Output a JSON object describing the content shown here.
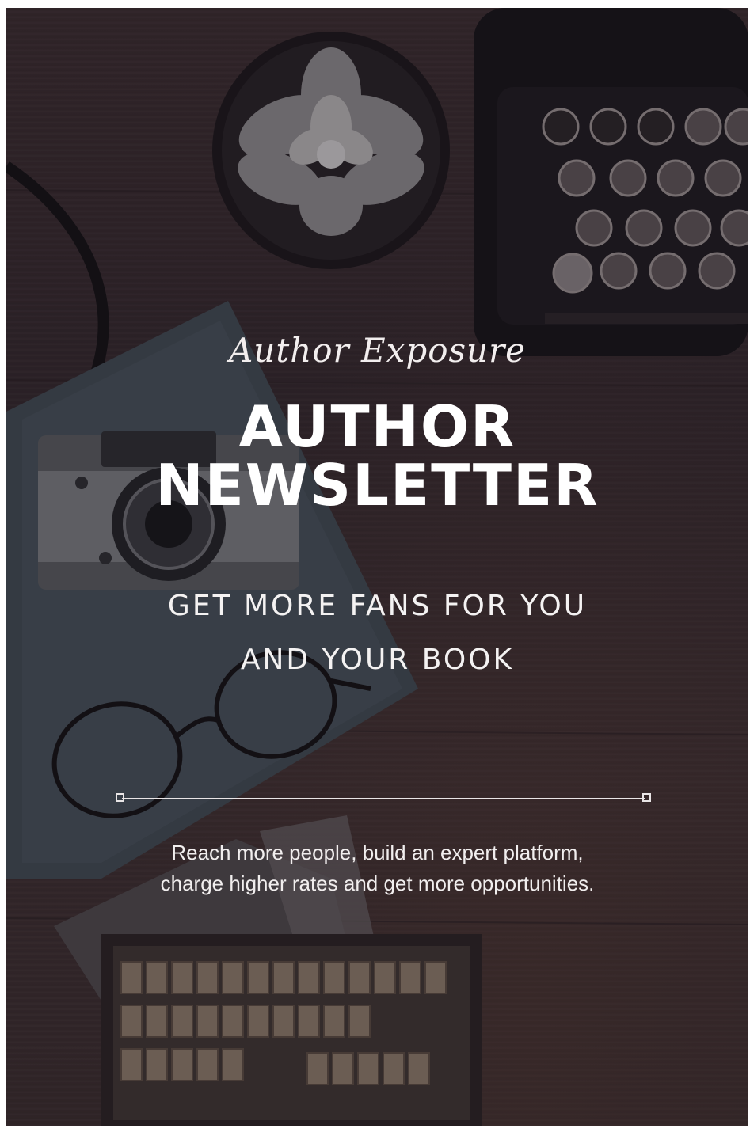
{
  "poster": {
    "script_title": "Author Exposure",
    "title_lines": [
      "AUTHOR",
      "NEWSLETTER"
    ],
    "tagline_lines": [
      "GET MORE FANS FOR YOU",
      "AND YOUR BOOK"
    ],
    "description_lines": [
      "Reach more people, build an expert platform,",
      "charge higher rates and get more opportunities."
    ]
  },
  "colors": {
    "background": "#35292d",
    "text": "#ffffff",
    "divider": "#e9e5e6"
  },
  "icons": [
    "succulent-plant-icon",
    "typewriter-icon",
    "camera-icon",
    "glasses-icon",
    "book-icon",
    "letter-stamps-icon"
  ]
}
